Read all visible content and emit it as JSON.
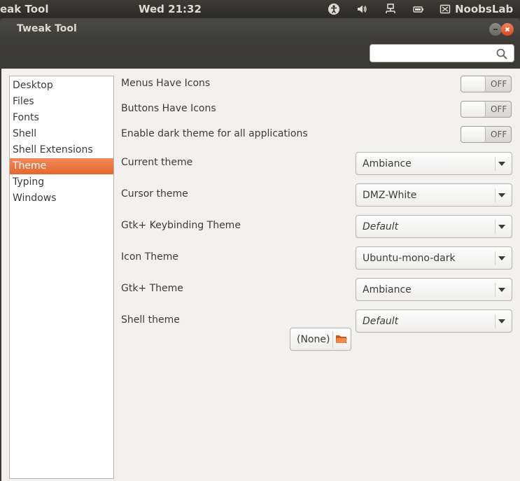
{
  "top_panel": {
    "app_name": "eak Tool",
    "clock": "Wed 21:32",
    "indicators": [
      "accessibility-icon",
      "volume-icon",
      "network-icon",
      "battery-icon"
    ],
    "user_name": "NoobsLab"
  },
  "window": {
    "title": "Tweak Tool",
    "search": {
      "value": "",
      "placeholder": ""
    }
  },
  "sidebar": {
    "items": [
      {
        "label": "Desktop"
      },
      {
        "label": "Files"
      },
      {
        "label": "Fonts"
      },
      {
        "label": "Shell"
      },
      {
        "label": "Shell Extensions"
      },
      {
        "label": "Theme",
        "selected": true
      },
      {
        "label": "Typing"
      },
      {
        "label": "Windows"
      }
    ]
  },
  "settings": {
    "toggles": [
      {
        "label": "Menus Have Icons",
        "state": "OFF"
      },
      {
        "label": "Buttons Have Icons",
        "state": "OFF"
      },
      {
        "label": "Enable dark theme for all applications",
        "state": "OFF"
      }
    ],
    "combos": [
      {
        "label": "Current theme",
        "value": "Ambiance"
      },
      {
        "label": "Cursor theme",
        "value": "DMZ-White"
      },
      {
        "label": "Gtk+ Keybinding Theme",
        "value": "Default"
      },
      {
        "label": "Icon Theme",
        "value": "Ubuntu-mono-dark"
      },
      {
        "label": "Gtk+ Theme",
        "value": "Ambiance"
      }
    ],
    "shell_theme": {
      "label": "Shell theme",
      "file_value": "(None)",
      "value": "Default"
    }
  },
  "colors": {
    "accent": "#e4692e",
    "panel": "#3c3b37",
    "background": "#f2f1f0",
    "close_button": "#d9471d"
  }
}
